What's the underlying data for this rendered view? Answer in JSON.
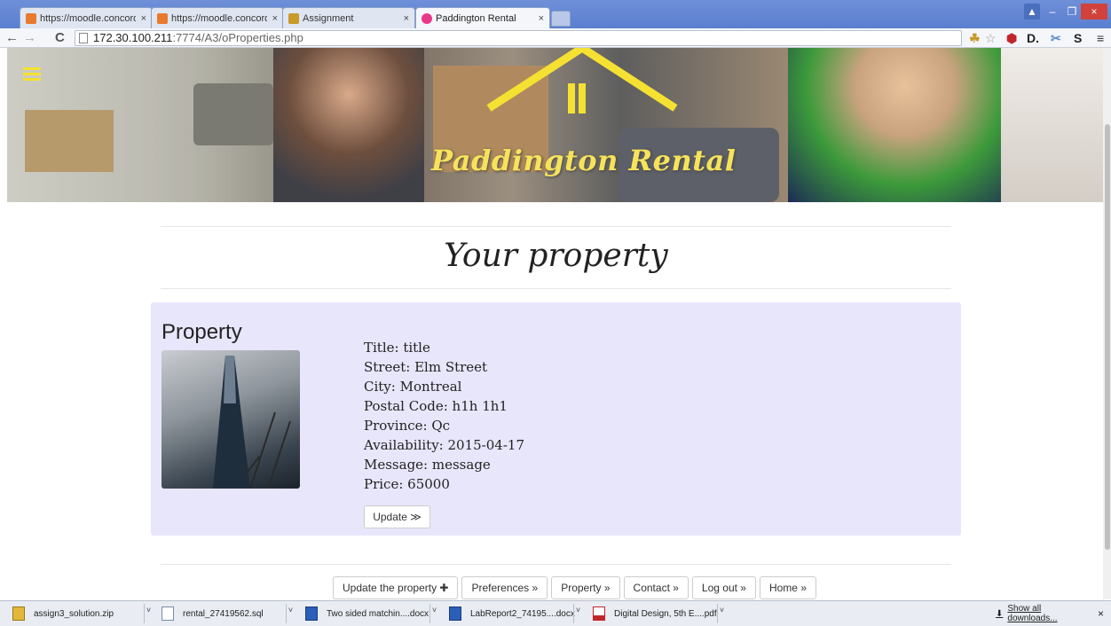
{
  "browser": {
    "tabs": [
      {
        "title": "https://moodle.concordia",
        "active": false
      },
      {
        "title": "https://moodle.concordia",
        "active": false
      },
      {
        "title": "Assignment",
        "active": false
      },
      {
        "title": "Paddington Rental",
        "active": true
      }
    ],
    "tab_close": "×",
    "url_host": "172.30.100.211",
    "url_path": ":7774/A3/oProperties.php",
    "back": "←",
    "forward": "→",
    "reload": "C",
    "menu": "≡",
    "win_minimize": "–",
    "win_restore": "❐",
    "win_close": "×"
  },
  "site": {
    "brand": "Paddington Rental",
    "page_title": "Your property"
  },
  "property": {
    "heading": "Property",
    "title": "Title: title",
    "street": "Street: Elm Street",
    "city": "City: Montreal",
    "postal": "Postal Code: h1h 1h1",
    "province": "Province: Qc",
    "availability": "Availability: 2015-04-17",
    "message": "Message: message",
    "price": "Price: 65000",
    "update_label": "Update ≫"
  },
  "nav_buttons": [
    "Update the property ✚",
    "Preferences »",
    "Property »",
    "Contact »",
    "Log out »",
    "Home »"
  ],
  "downloads": {
    "items": [
      {
        "name": "assign3_solution.zip",
        "icon": "zip-icon"
      },
      {
        "name": "rental_27419562.sql",
        "icon": "file-icon"
      },
      {
        "name": "Two sided matchin....docx",
        "icon": "word-icon"
      },
      {
        "name": "LabReport2_74195....docx",
        "icon": "word-icon"
      },
      {
        "name": "Digital Design, 5th E....pdf",
        "icon": "pdf-icon"
      }
    ],
    "show_all": "Show all downloads...",
    "close": "×"
  },
  "colors": {
    "accent_yellow": "#f5e132",
    "card_bg": "#e8e6fb",
    "chrome_blue": "#6f8fd8"
  }
}
